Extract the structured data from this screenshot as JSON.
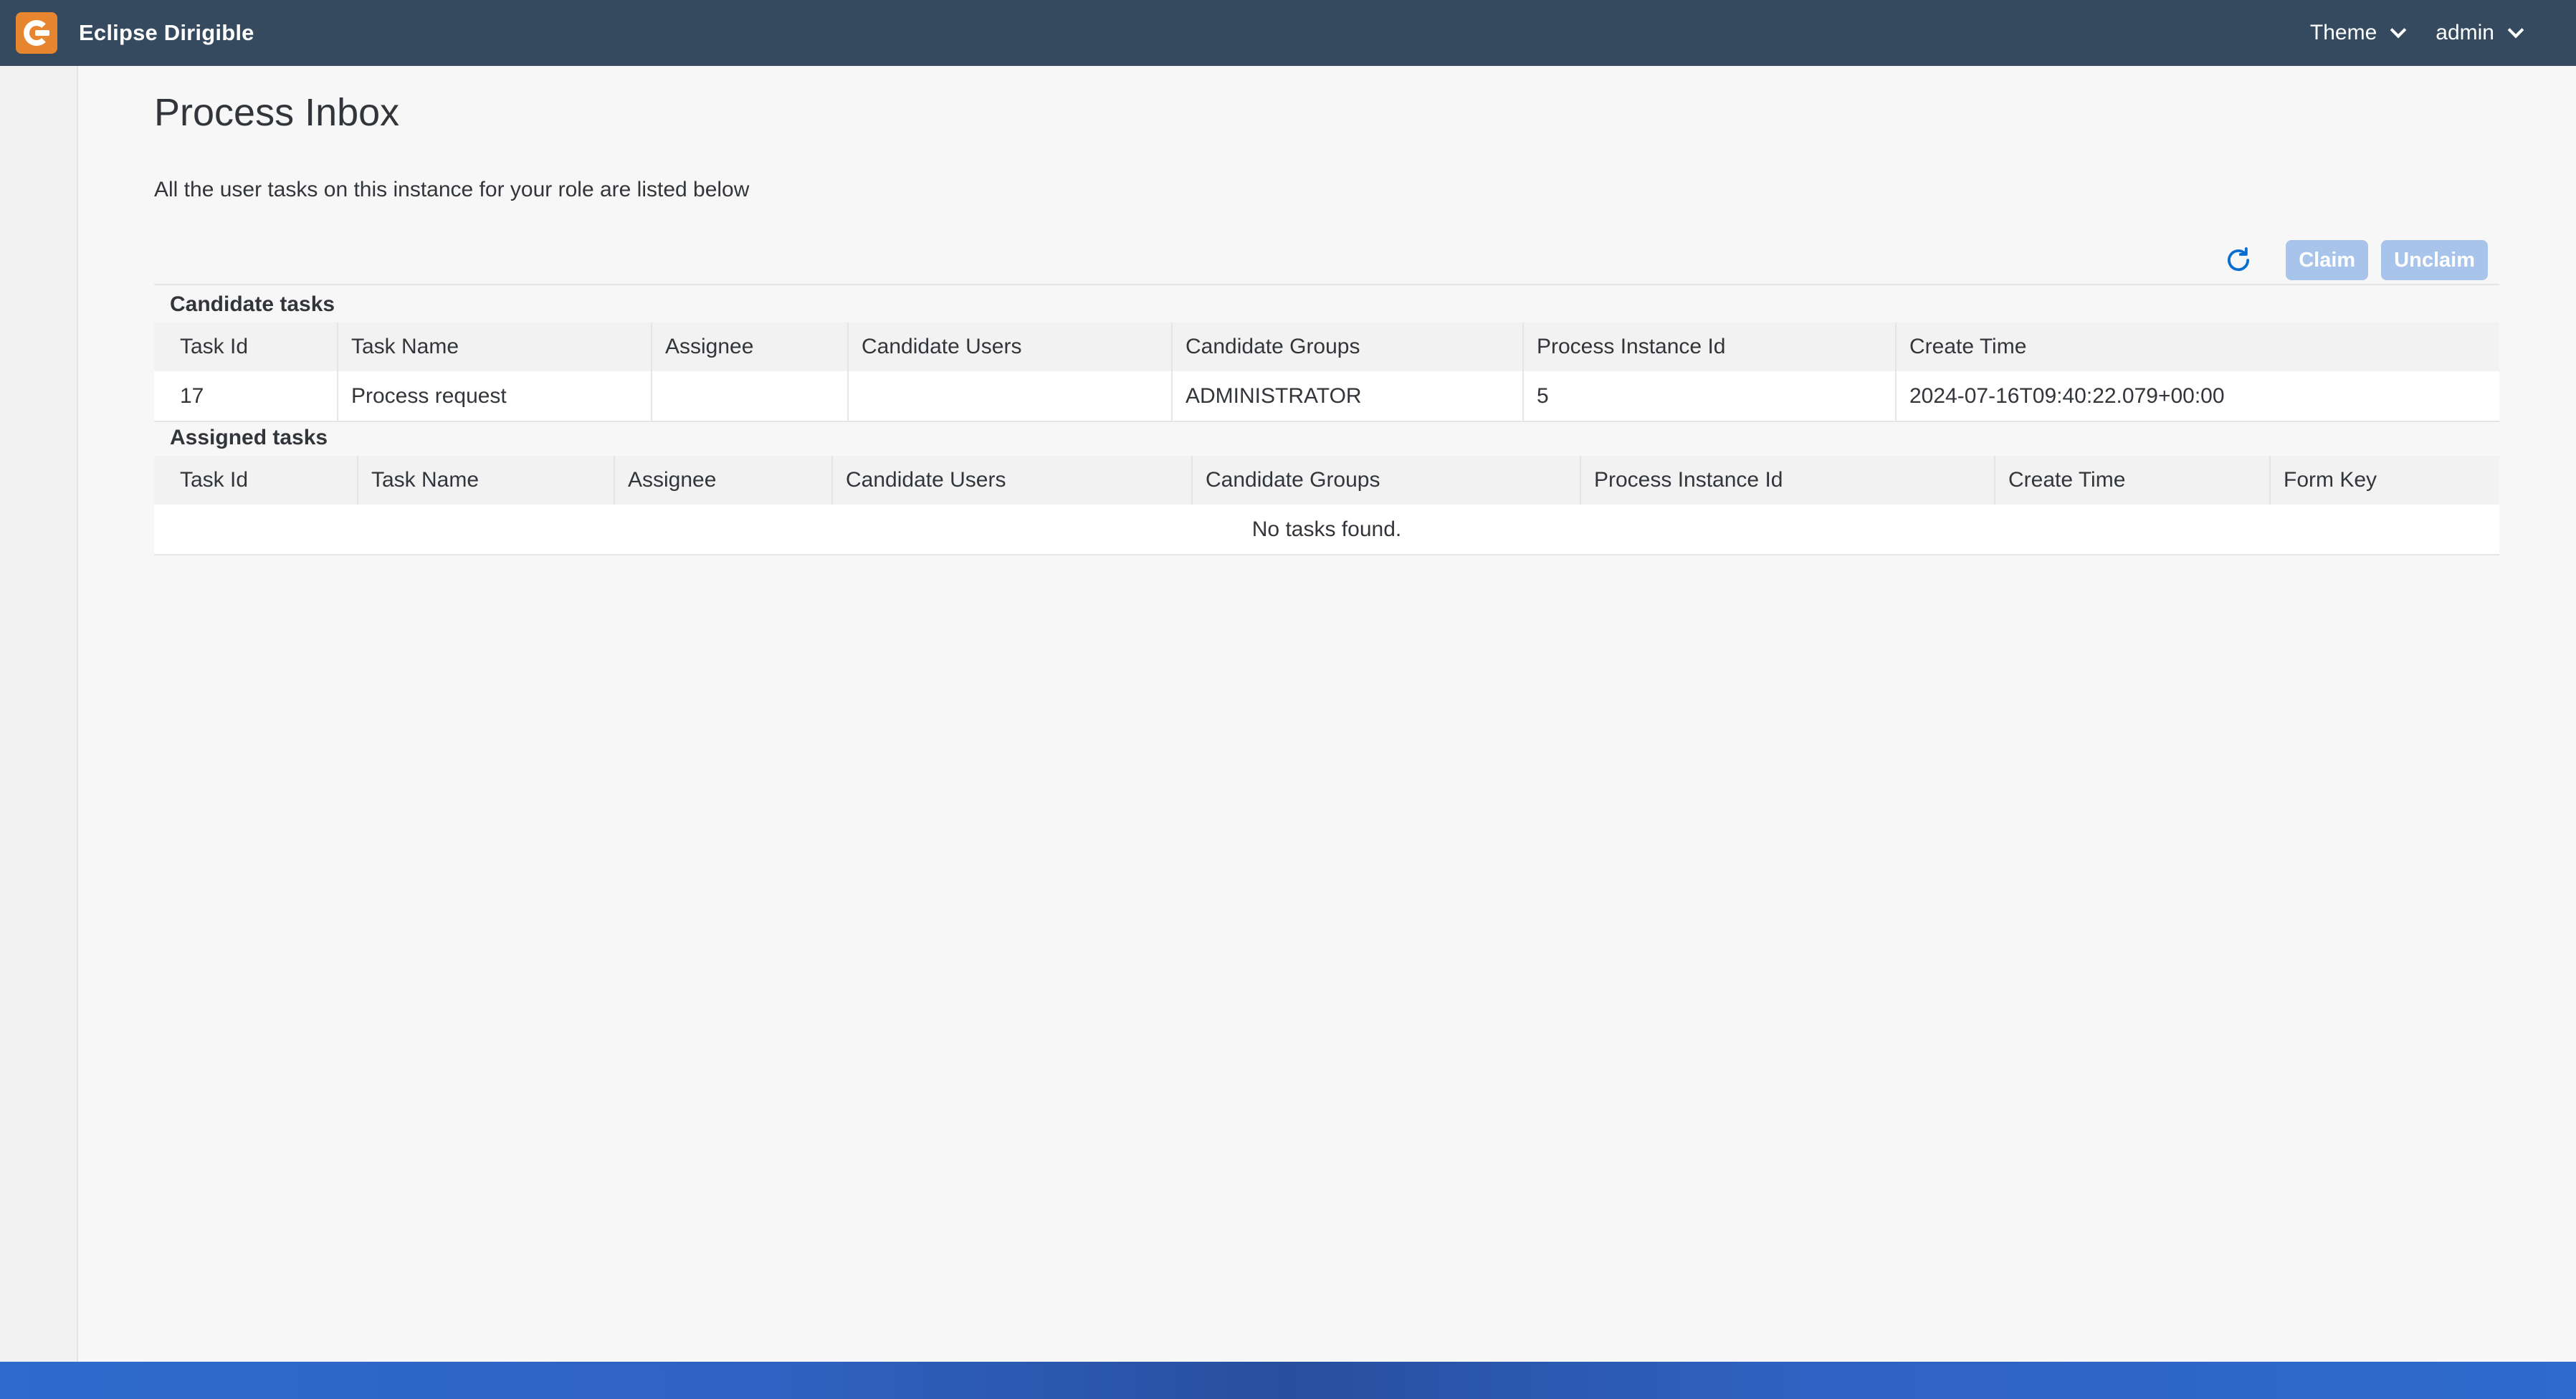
{
  "shell": {
    "product_title": "Eclipse Dirigible",
    "theme_label": "Theme",
    "user_label": "admin"
  },
  "page": {
    "title": "Process Inbox",
    "description": "All the user tasks on this instance for your role are listed below"
  },
  "toolbar": {
    "refresh_icon": "refresh-icon",
    "claim_label": "Claim",
    "unclaim_label": "Unclaim"
  },
  "candidate_tasks": {
    "label": "Candidate tasks",
    "columns": [
      "Task Id",
      "Task Name",
      "Assignee",
      "Candidate Users",
      "Candidate Groups",
      "Process Instance Id",
      "Create Time"
    ],
    "rows": [
      {
        "task_id": "17",
        "task_name": "Process request",
        "assignee": "",
        "candidate_users": "",
        "candidate_groups": "ADMINISTRATOR",
        "process_instance_id": "5",
        "create_time": "2024-07-16T09:40:22.079+00:00"
      }
    ]
  },
  "assigned_tasks": {
    "label": "Assigned tasks",
    "columns": [
      "Task Id",
      "Task Name",
      "Assignee",
      "Candidate Users",
      "Candidate Groups",
      "Process Instance Id",
      "Create Time",
      "Form Key"
    ],
    "empty_message": "No tasks found."
  },
  "colors": {
    "shell_background": "#354a5f",
    "logo_orange": "#e8852f",
    "disabled_button": "#a8c4ea",
    "refresh_icon": "#0a6ed1",
    "status_bar": "#2e6bcc"
  }
}
